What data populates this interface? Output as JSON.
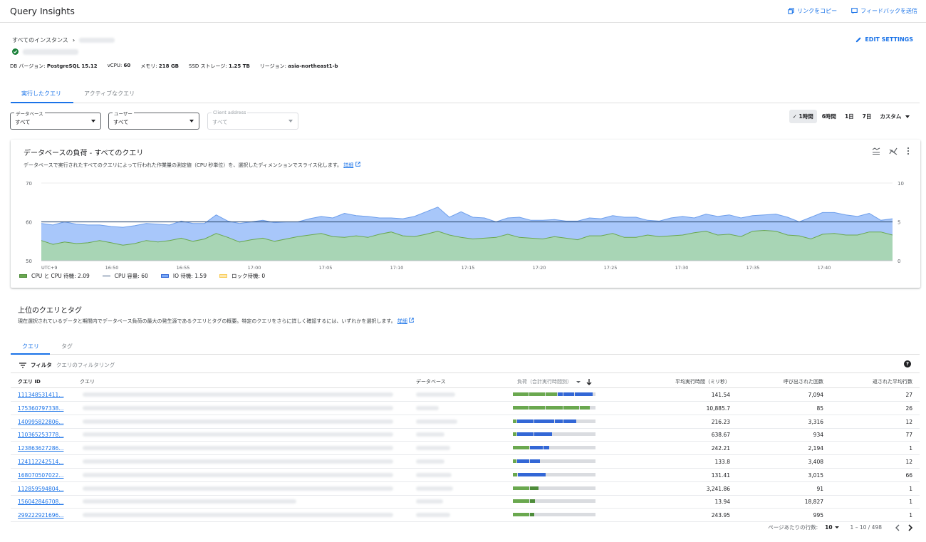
{
  "app": {
    "title": "Query Insights"
  },
  "top_actions": {
    "copy_link": "リンクをコピー",
    "feedback": "フィードバックを送信"
  },
  "breadcrumb": {
    "all_instances": "すべてのインスタンス",
    "separator": "›"
  },
  "edit_settings": "EDIT SETTINGS",
  "instance_meta": [
    {
      "label": "DB バージョン: ",
      "value": "PostgreSQL 15.12"
    },
    {
      "label": "vCPU: ",
      "value": "60"
    },
    {
      "label": "メモリ: ",
      "value": "218 GB"
    },
    {
      "label": "SSD ストレージ: ",
      "value": "1.25 TB"
    },
    {
      "label": "リージョン: ",
      "value": "asia-northeast1-b"
    }
  ],
  "main_tabs": {
    "executed": "実行したクエリ",
    "active": "アクティブなクエリ"
  },
  "filters": {
    "database": {
      "label": "データベース",
      "value": "すべて"
    },
    "user": {
      "label": "ユーザー",
      "value": "すべて"
    },
    "client": {
      "label": "Client address",
      "value": "すべて"
    }
  },
  "time_ranges": {
    "selected_check": "✓",
    "r1h": "1時間",
    "r6h": "6時間",
    "r1d": "1日",
    "r7d": "7日",
    "custom": "カスタム"
  },
  "load_card": {
    "title": "データベースの負荷 - すべてのクエリ",
    "description": "データベースで実行されたすべてのクエリによって行われた作業量の測定値（CPU 秒単位）を、選択したディメンションでスライス化します。",
    "details_link": "詳細",
    "legend": {
      "cpu": "CPU と CPU 待機: 2.09",
      "capacity": "CPU 容量: 60",
      "io": "IO 待機: 1.59",
      "lock": "ロック待機: 0"
    }
  },
  "chart_data": {
    "type": "area",
    "x_ticks": [
      "UTC+9",
      "16:50",
      "16:55",
      "17:00",
      "17:05",
      "17:10",
      "17:15",
      "17:20",
      "17:25",
      "17:30",
      "17:35",
      "17:40"
    ],
    "y_left_ticks": [
      "70",
      "60",
      "50"
    ],
    "y_left_range": [
      50,
      70
    ],
    "y_right_ticks": [
      "10",
      "5",
      "0"
    ],
    "y_right_range": [
      0,
      10
    ],
    "capacity_line": 60,
    "series": [
      {
        "name": "CPU と CPU 待機",
        "color": "#a8d5b5",
        "values": [
          2.6,
          2.1,
          2.4,
          2.2,
          2.3,
          2.6,
          2.3,
          2.0,
          2.2,
          2.6,
          2.4,
          2.6,
          2.9,
          2.5,
          2.8,
          3.5,
          3.0,
          2.4,
          2.7,
          2.9,
          2.5,
          2.8,
          3.1,
          3.3,
          3.5,
          3.1,
          3.0,
          3.2,
          3.0,
          3.4,
          3.7,
          3.2,
          3.1,
          3.4,
          3.8,
          3.3,
          3.0,
          2.8,
          2.9,
          3.0,
          3.4,
          3.0,
          2.9,
          2.8,
          3.1,
          2.9,
          2.7,
          3.2,
          3.2,
          3.5,
          3.0,
          3.0,
          3.3,
          3.1,
          3.2,
          3.3,
          3.6,
          3.8,
          3.3,
          3.4,
          3.1,
          3.8,
          3.9,
          3.8,
          3.3,
          3.2,
          2.8,
          3.4,
          3.5,
          3.3,
          3.3,
          3.7,
          3.7,
          3.3
        ]
      },
      {
        "name": "IO 待機",
        "color": "#a8c7fa",
        "values": [
          2.2,
          2.5,
          2.6,
          2.5,
          2.3,
          2.0,
          2.1,
          2.3,
          2.3,
          2.2,
          2.3,
          2.0,
          2.2,
          2.3,
          2.0,
          2.4,
          2.1,
          2.4,
          2.3,
          2.3,
          2.4,
          2.2,
          1.9,
          2.1,
          2.2,
          2.4,
          3.1,
          2.6,
          2.7,
          2.1,
          1.8,
          2.2,
          2.6,
          2.9,
          3.1,
          2.3,
          3.3,
          2.8,
          2.6,
          2.0,
          2.1,
          2.6,
          2.3,
          2.4,
          2.2,
          2.2,
          2.4,
          2.3,
          2.2,
          2.3,
          2.6,
          2.6,
          1.9,
          2.0,
          2.3,
          2.4,
          1.9,
          2.2,
          2.4,
          2.5,
          2.4,
          2.0,
          2.0,
          2.2,
          2.3,
          1.8,
          2.8,
          2.8,
          2.7,
          2.6,
          2.4,
          2.4,
          1.5,
          2.1
        ]
      }
    ]
  },
  "top_queries": {
    "title": "上位のクエリとタグ",
    "description": "現在選択されているデータと期間内でデータベース負荷の最大の発生源であるクエリとタグの概要。特定のクエリをさらに詳しく確認するには、いずれかを選択します。",
    "details_link": "詳細",
    "tabs": {
      "queries": "クエリ",
      "tags": "タグ"
    },
    "filter_label": "フィルタ",
    "filter_placeholder": "クエリのフィルタリング",
    "columns": {
      "id": "クエリ ID",
      "query": "クエリ",
      "database": "データベース",
      "load": "負荷（合計実行時間別）",
      "avg_time": "平均実行時間（ミリ秒）",
      "calls": "呼び出された回数",
      "avg_rows": "返された平均行数"
    },
    "rows": [
      {
        "id": "111348531411...",
        "avg_time": "141.54",
        "calls": "7,094",
        "avg_rows": "27",
        "load": [
          {
            "t": "g",
            "w": 0.19
          },
          {
            "t": "g",
            "w": 0.19
          },
          {
            "t": "g",
            "w": 0.14
          },
          {
            "t": "b",
            "w": 0.06
          },
          {
            "t": "b",
            "w": 0.13
          },
          {
            "t": "b",
            "w": 0.21
          }
        ]
      },
      {
        "id": "175360797338...",
        "avg_time": "10,885.7",
        "calls": "85",
        "avg_rows": "26",
        "load": [
          {
            "t": "g",
            "w": 0.19
          },
          {
            "t": "g",
            "w": 0.19
          },
          {
            "t": "g",
            "w": 0.21
          },
          {
            "t": "g",
            "w": 0.19
          },
          {
            "t": "g",
            "w": 0.12
          }
        ]
      },
      {
        "id": "140995822806...",
        "avg_time": "216.23",
        "calls": "3,316",
        "avg_rows": "12",
        "load": [
          {
            "t": "g",
            "w": 0.04
          },
          {
            "t": "b",
            "w": 0.2
          },
          {
            "t": "b",
            "w": 0.24
          },
          {
            "t": "b",
            "w": 0.1
          },
          {
            "t": "b",
            "w": 0.15
          }
        ]
      },
      {
        "id": "110365253778...",
        "avg_time": "638.67",
        "calls": "934",
        "avg_rows": "77",
        "load": [
          {
            "t": "g",
            "w": 0.04
          },
          {
            "t": "b",
            "w": 0.2
          },
          {
            "t": "b",
            "w": 0.22
          }
        ]
      },
      {
        "id": "123863627286...",
        "avg_time": "242.21",
        "calls": "2,194",
        "avg_rows": "1",
        "load": [
          {
            "t": "g",
            "w": 0.2
          },
          {
            "t": "b",
            "w": 0.15
          },
          {
            "t": "b",
            "w": 0.07
          }
        ]
      },
      {
        "id": "124112242514...",
        "avg_time": "133.8",
        "calls": "3,408",
        "avg_rows": "12",
        "load": [
          {
            "t": "g",
            "w": 0.04
          },
          {
            "t": "b",
            "w": 0.15
          },
          {
            "t": "b",
            "w": 0.12
          }
        ]
      },
      {
        "id": "168070507022...",
        "avg_time": "131.41",
        "calls": "3,015",
        "avg_rows": "66",
        "load": [
          {
            "t": "g",
            "w": 0.05
          },
          {
            "t": "b",
            "w": 0.34
          }
        ]
      },
      {
        "id": "112859594804...",
        "avg_time": "3,241.86",
        "calls": "91",
        "avg_rows": "1",
        "load": [
          {
            "t": "g",
            "w": 0.2
          },
          {
            "t": "g2",
            "w": 0.1
          }
        ]
      },
      {
        "id": "156042846708...",
        "avg_time": "13.94",
        "calls": "18,827",
        "avg_rows": "1",
        "load": [
          {
            "t": "g",
            "w": 0.2
          },
          {
            "t": "g2",
            "w": 0.06
          }
        ]
      },
      {
        "id": "299222921696...",
        "avg_time": "243.95",
        "calls": "995",
        "avg_rows": "1",
        "load": [
          {
            "t": "g",
            "w": 0.2
          },
          {
            "t": "g2",
            "w": 0.05
          }
        ]
      }
    ]
  },
  "pagination": {
    "rows_per_page_label": "ページあたりの行数:",
    "rows_per_page": "10",
    "range": "1 – 10 / 498"
  },
  "colors": {
    "accent": "#1a73e8",
    "cpu_green": "#6aa84f",
    "io_blue": "#3367d6",
    "capacity_line": "#3d5a80",
    "lock_yellow": "#f9cb53"
  }
}
